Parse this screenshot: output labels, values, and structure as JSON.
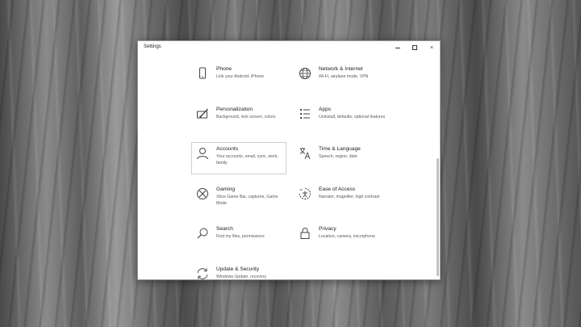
{
  "window": {
    "title": "Settings",
    "controls": {
      "minimize": "minimize-icon",
      "maximize": "maximize-icon",
      "close": "×"
    }
  },
  "items": [
    {
      "name": "Phone",
      "desc": "Link your Android, iPhone",
      "icon": "phone-icon"
    },
    {
      "name": "Network & Internet",
      "desc": "Wi-Fi, airplane mode, VPN",
      "icon": "globe-icon"
    },
    {
      "name": "Personalization",
      "desc": "Background, lock screen, colors",
      "icon": "paint-brush-icon"
    },
    {
      "name": "Apps",
      "desc": "Uninstall, defaults, optional features",
      "icon": "apps-list-icon"
    },
    {
      "name": "Accounts",
      "desc": "Your accounts, email, sync, work, family",
      "icon": "person-icon"
    },
    {
      "name": "Time & Language",
      "desc": "Speech, region, date",
      "icon": "time-language-icon"
    },
    {
      "name": "Gaming",
      "desc": "Xbox Game Bar, captures, Game Mode",
      "icon": "xbox-icon"
    },
    {
      "name": "Ease of Access",
      "desc": "Narrator, magnifier, high contrast",
      "icon": "ease-of-access-icon"
    },
    {
      "name": "Search",
      "desc": "Find my files, permissions",
      "icon": "search-icon"
    },
    {
      "name": "Privacy",
      "desc": "Location, camera, microphone",
      "icon": "lock-icon"
    },
    {
      "name": "Update & Security",
      "desc": "Windows Update, recovery",
      "icon": "sync-icon"
    }
  ],
  "selected_item": "Accounts"
}
